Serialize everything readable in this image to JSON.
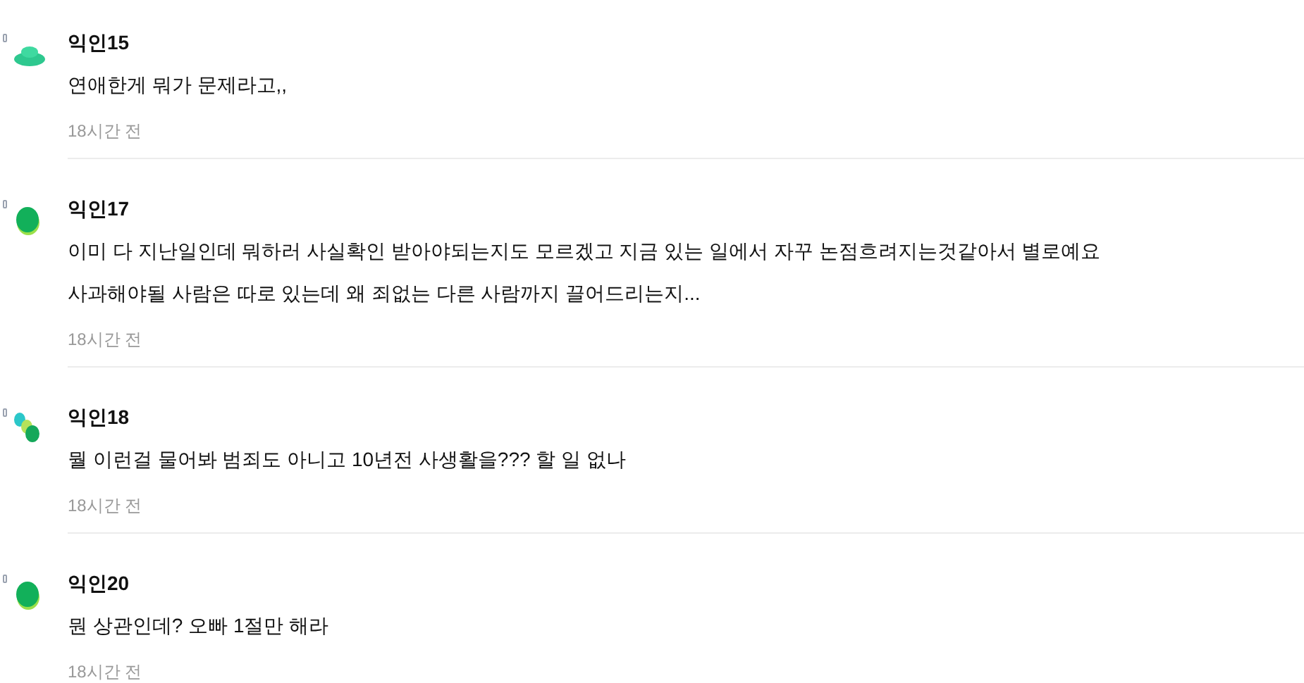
{
  "comments": [
    {
      "author": "익인15",
      "avatar": {
        "kind": "disc"
      },
      "lines": [
        "연애한게 뭐가 문제라고,,"
      ],
      "time": "18시간 전"
    },
    {
      "author": "익인17",
      "avatar": {
        "kind": "oval"
      },
      "lines": [
        "이미 다 지난일인데 뭐하러 사실확인 받아야되는지도 모르겠고 지금 있는 일에서 자꾸 논점흐려지는것같아서 별로예요",
        "사과해야될 사람은 따로 있는데 왜 죄없는 다른 사람까지 끌어드리는지..."
      ],
      "time": "18시간 전"
    },
    {
      "author": "익인18",
      "avatar": {
        "kind": "cluster"
      },
      "lines": [
        "뭘 이런걸 물어봐 범죄도 아니고 10년전 사생활을??? 할 일 없나"
      ],
      "time": "18시간 전"
    },
    {
      "author": "익인20",
      "avatar": {
        "kind": "oval"
      },
      "lines": [
        "뭔 상관인데? 오빠 1절만 해라"
      ],
      "time": "18시간 전"
    }
  ]
}
